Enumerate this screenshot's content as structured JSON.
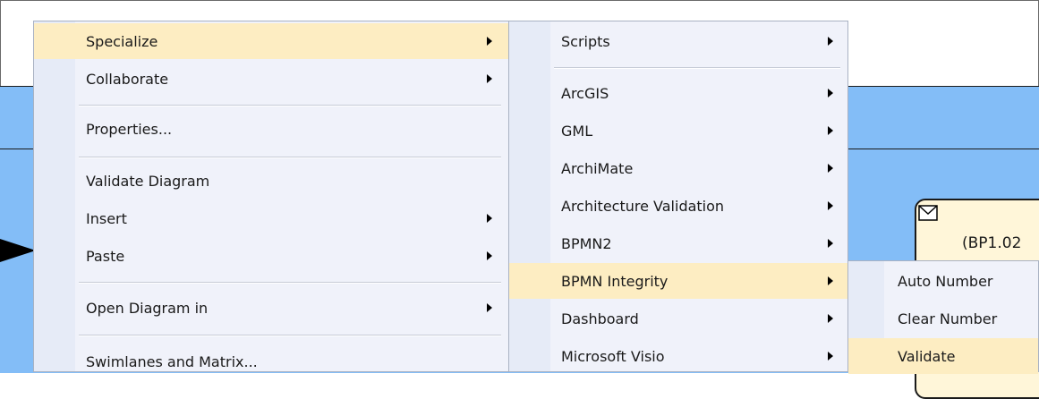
{
  "menu1": {
    "items": [
      {
        "label": "Specialize",
        "submenu": true,
        "highlighted": true
      },
      {
        "label": "Collaborate",
        "submenu": true
      },
      {
        "label": "Properties...",
        "submenu": false
      },
      {
        "label": "Validate Diagram",
        "submenu": false
      },
      {
        "label": "Insert",
        "submenu": true
      },
      {
        "label": "Paste",
        "submenu": true
      },
      {
        "label": "Open Diagram in",
        "submenu": true
      },
      {
        "label": "Swimlanes and Matrix...",
        "submenu": false
      }
    ]
  },
  "menu2": {
    "items": [
      {
        "label": "Scripts",
        "submenu": true
      },
      {
        "label": "ArcGIS",
        "submenu": true
      },
      {
        "label": "GML",
        "submenu": true
      },
      {
        "label": "ArchiMate",
        "submenu": true
      },
      {
        "label": "Architecture Validation",
        "submenu": true
      },
      {
        "label": "BPMN2",
        "submenu": true
      },
      {
        "label": "BPMN Integrity",
        "submenu": true,
        "highlighted": true
      },
      {
        "label": "Dashboard",
        "submenu": true
      },
      {
        "label": "Microsoft Visio",
        "submenu": true
      }
    ]
  },
  "menu3": {
    "items": [
      {
        "label": "Auto Number"
      },
      {
        "label": "Clear Number"
      },
      {
        "label": "Validate",
        "highlighted": true
      }
    ]
  },
  "diagram": {
    "task_label": "(BP1.02",
    "task_icon": "envelope-icon"
  },
  "colors": {
    "menu_bg": "#f0f2fa",
    "menu_gutter": "#e6ebf7",
    "highlight": "#fdedc2",
    "lane": "#83bdf7",
    "task_fill": "#fff6d9"
  }
}
